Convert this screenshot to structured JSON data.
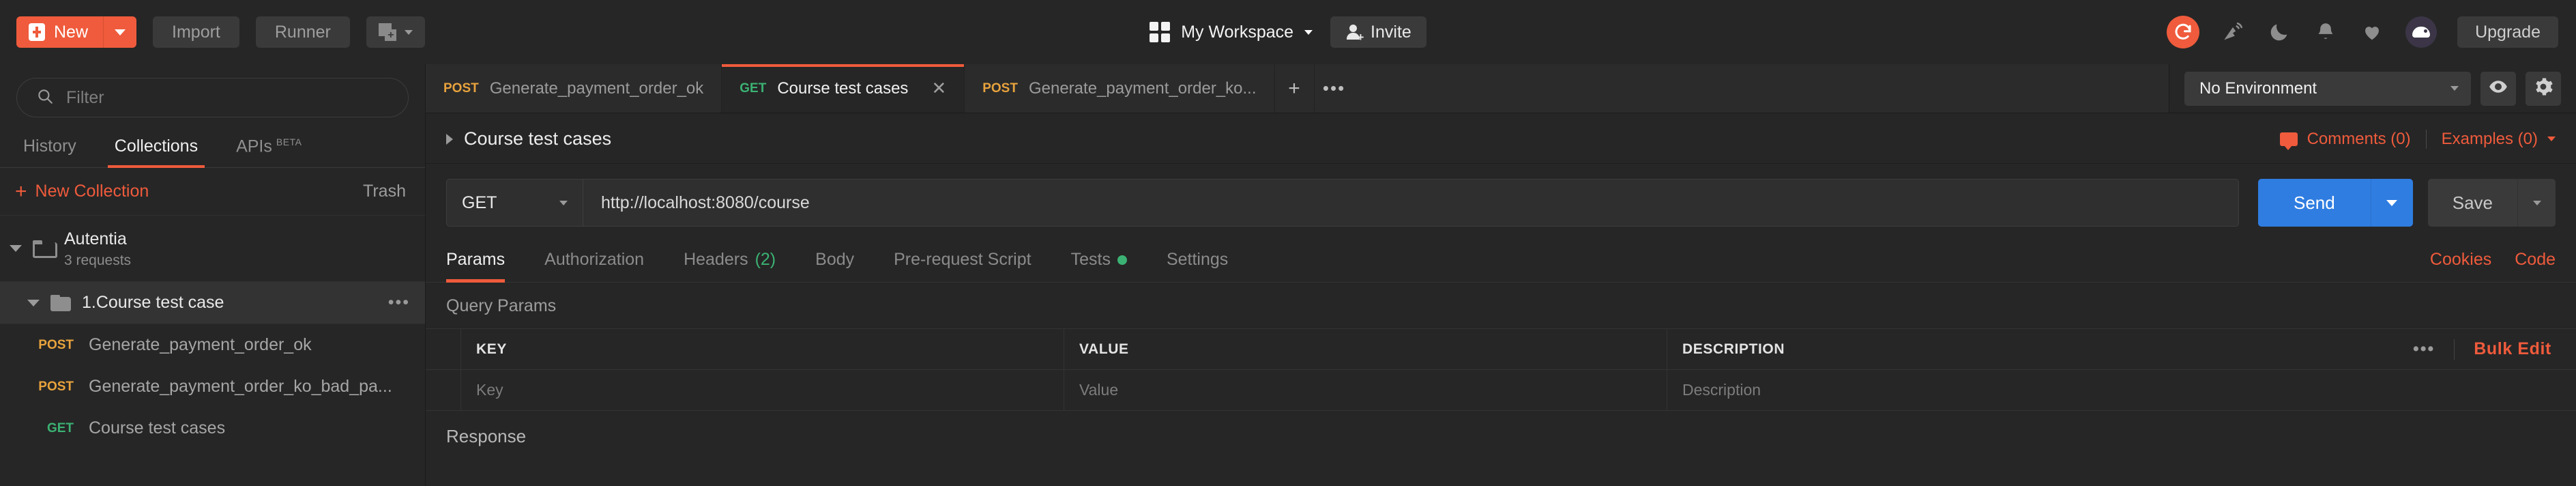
{
  "topbar": {
    "new_button": {
      "label": "New",
      "icon": "plus-icon"
    },
    "import_button": "Import",
    "runner_button": "Runner",
    "copy_button_icon": "new-window-icon",
    "workspace": {
      "label": "My Workspace",
      "icon": "grid-icon"
    },
    "invite_button": {
      "label": "Invite",
      "icon": "person-add-icon"
    },
    "right_icons": [
      "sync-icon",
      "broadcast-icon",
      "moon-icon",
      "bell-icon",
      "heart-icon",
      "avatar"
    ],
    "upgrade_button": "Upgrade"
  },
  "sidebar": {
    "filter": {
      "placeholder": "Filter",
      "value": "",
      "icon": "search-icon"
    },
    "tabs": [
      {
        "label": "History",
        "active": false
      },
      {
        "label": "Collections",
        "active": true
      },
      {
        "label": "APIs",
        "badge": "BETA",
        "active": false
      }
    ],
    "new_collection": "New Collection",
    "trash": "Trash",
    "collection": {
      "name": "Autentia",
      "meta": "3 requests",
      "folder": {
        "name": "1.Course test case",
        "more": "•••"
      },
      "requests": [
        {
          "method": "POST",
          "name": "Generate_payment_order_ok"
        },
        {
          "method": "POST",
          "name": "Generate_payment_order_ko_bad_pa..."
        },
        {
          "method": "GET",
          "name": "Course test cases"
        }
      ]
    }
  },
  "tabstrip": {
    "tabs": [
      {
        "method": "POST",
        "name": "Generate_payment_order_ok",
        "active": false,
        "closable": false
      },
      {
        "method": "GET",
        "name": "Course test cases",
        "active": true,
        "closable": true,
        "close": "✕"
      },
      {
        "method": "POST",
        "name": "Generate_payment_order_ko...",
        "active": false,
        "closable": false
      }
    ],
    "add": "+",
    "more": "•••",
    "environment": {
      "selected": "No Environment",
      "eye_icon": "eye-icon",
      "gear_icon": "gear-icon"
    }
  },
  "request": {
    "breadcrumb": "Course test cases",
    "comments": "Comments (0)",
    "examples": "Examples (0)",
    "method": "GET",
    "url": "http://localhost:8080/course",
    "send_label": "Send",
    "save_label": "Save",
    "tabs": [
      {
        "label": "Params",
        "active": true
      },
      {
        "label": "Authorization",
        "active": false
      },
      {
        "label": "Headers",
        "count": "(2)",
        "active": false
      },
      {
        "label": "Body",
        "active": false
      },
      {
        "label": "Pre-request Script",
        "active": false
      },
      {
        "label": "Tests",
        "dot": true,
        "active": false
      },
      {
        "label": "Settings",
        "active": false
      }
    ],
    "cookies_link": "Cookies",
    "code_link": "Code",
    "query_params_title": "Query Params",
    "table": {
      "headers": [
        "KEY",
        "VALUE",
        "DESCRIPTION"
      ],
      "rows": [
        {
          "key": "Key",
          "value": "Value",
          "description": "Description"
        }
      ],
      "more": "•••",
      "bulk_edit": "Bulk Edit"
    },
    "response_label": "Response"
  },
  "colors": {
    "accent": "#ef5b3c",
    "send": "#2f7de1",
    "post": "#e8a33d",
    "get": "#3bb273",
    "bg": "#262626"
  }
}
